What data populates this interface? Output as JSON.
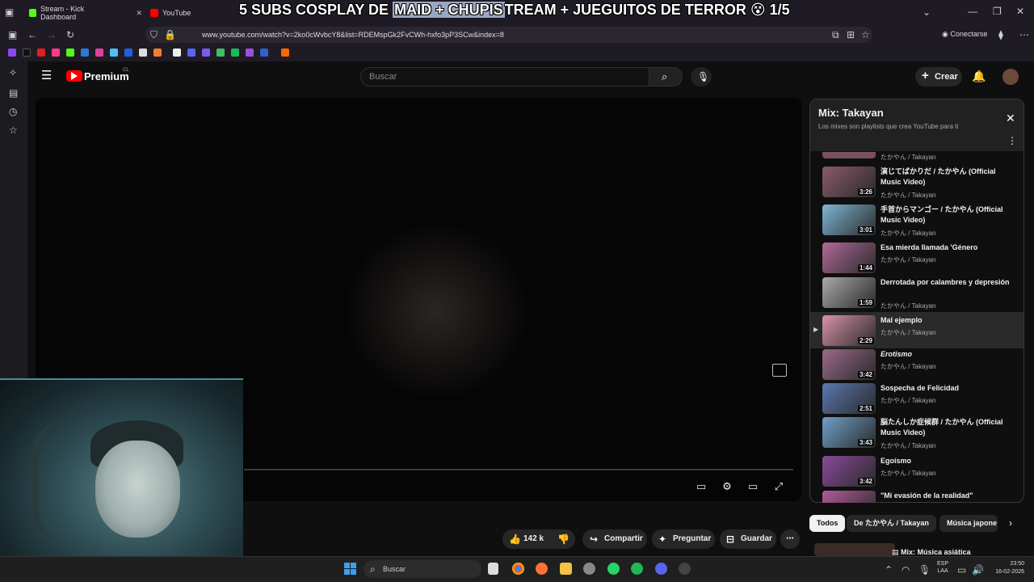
{
  "browser": {
    "tabs": [
      {
        "label": "Stream - Kick Dashboard"
      },
      {
        "label": "YouTube"
      }
    ],
    "url": "www.youtube.com/watch?v=2ko0cWvbcY8&list=RDEMspGk2FvCWh-hxfo3pP3SCw&index=8",
    "connect_label": "Conectarse",
    "stream_overlay": {
      "part1": "5 SUBS COSPLAY DE ",
      "highlight1": "MAID + CHUPIS",
      "part2": "TREAM + JUEGUITOS DE TERROR 😵 1/5"
    }
  },
  "youtube": {
    "logo_label": "Premium",
    "logo_region": "CL",
    "search_placeholder": "Buscar",
    "create_label": "Crear",
    "actions": {
      "likes": "142 k",
      "share": "Compartir",
      "ask": "Preguntar",
      "save": "Guardar"
    },
    "playlist": {
      "title": "Mix: Takayan",
      "subtitle": "Los mixes son playlists que crea YouTube para ti",
      "top_channel": "たかやん / Takayan",
      "items": [
        {
          "title": "演じてばかりだ / たかやん (Official Music Video)",
          "channel": "たかやん / Takayan",
          "duration": "3:26",
          "color": "#8a5a6a"
        },
        {
          "title": "手首からマンゴー / たかやん (Official Music Video)",
          "channel": "たかやん / Takayan",
          "duration": "3:01",
          "color": "#7fb6d6"
        },
        {
          "title": "Esa mierda llamada 'Género",
          "channel": "たかやん / Takayan",
          "duration": "1:44",
          "color": "#b06a98"
        },
        {
          "title": "Derrotada por calambres y depresión",
          "channel": "たかやん / Takayan",
          "duration": "1:59",
          "color": "#a9a9a9"
        },
        {
          "title": "Mal ejemplo",
          "channel": "たかやん / Takayan",
          "duration": "2:29",
          "color": "#d892a8"
        },
        {
          "title": "Erotismo",
          "channel": "たかやん / Takayan",
          "duration": "3:42",
          "color": "#9a6a8a"
        },
        {
          "title": "Sospecha de Felicidad",
          "channel": "たかやん / Takayan",
          "duration": "2:51",
          "color": "#5a78b0"
        },
        {
          "title": "脳たんしか症候群 / たかやん (Official Music Video)",
          "channel": "たかやん / Takayan",
          "duration": "3:43",
          "color": "#6fa0c8"
        },
        {
          "title": "Egoísmo",
          "channel": "たかやん / Takayan",
          "duration": "3:42",
          "color": "#8a4a9a"
        },
        {
          "title": "\"Mi evasión de la realidad\"",
          "channel": "",
          "duration": "",
          "color": "#b05a9a"
        }
      ],
      "active_index": 4
    },
    "chips": [
      "Todos",
      "De たかやん / Takayan",
      "Música japone"
    ],
    "recommended_title": "Mix: Música asiática"
  },
  "taskbar": {
    "search_placeholder": "Buscar",
    "lang": "ESP",
    "lang2": "LAA",
    "time": "23:50",
    "date": "16-02-2026"
  }
}
